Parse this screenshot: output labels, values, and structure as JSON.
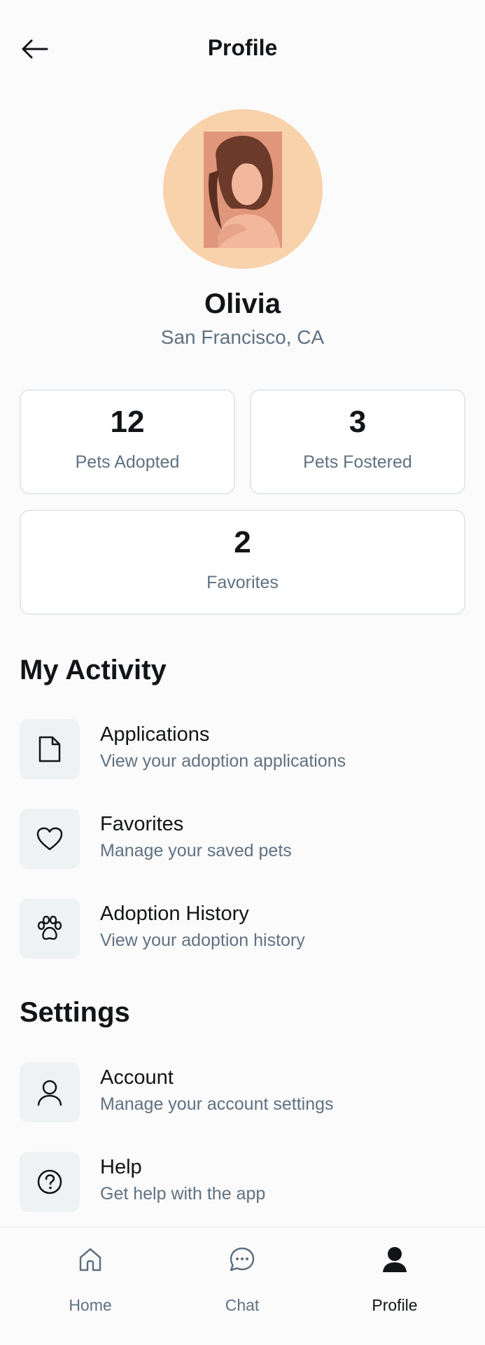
{
  "header": {
    "title": "Profile",
    "back_icon": "arrow-left-icon"
  },
  "profile": {
    "name": "Olivia",
    "location": "San Francisco, CA",
    "avatar_icon": "woman-portrait-avatar"
  },
  "stats": [
    {
      "value": "12",
      "label": "Pets Adopted"
    },
    {
      "value": "3",
      "label": "Pets Fostered"
    },
    {
      "value": "2",
      "label": "Favorites"
    }
  ],
  "activity": {
    "title": "My Activity",
    "items": [
      {
        "label": "Applications",
        "sub": "View your adoption applications",
        "icon": "document-icon"
      },
      {
        "label": "Favorites",
        "sub": "Manage your saved pets",
        "icon": "heart-icon"
      },
      {
        "label": "Adoption History",
        "sub": "View your adoption history",
        "icon": "paw-icon"
      }
    ]
  },
  "settings": {
    "title": "Settings",
    "items": [
      {
        "label": "Account",
        "sub": "Manage your account settings",
        "icon": "user-icon"
      },
      {
        "label": "Help",
        "sub": "Get help with the app",
        "icon": "help-circle-icon"
      }
    ]
  },
  "nav": {
    "items": [
      {
        "label": "Home",
        "icon": "home-icon",
        "active": false
      },
      {
        "label": "Chat",
        "icon": "chat-bubble-icon",
        "active": false
      },
      {
        "label": "Profile",
        "icon": "user-filled-icon",
        "active": true
      }
    ]
  },
  "colors": {
    "accent_text": "#121417",
    "muted_text": "#5f7180",
    "avatar_bg": "#f7d2ab",
    "icon_box": "#eff2f3"
  }
}
